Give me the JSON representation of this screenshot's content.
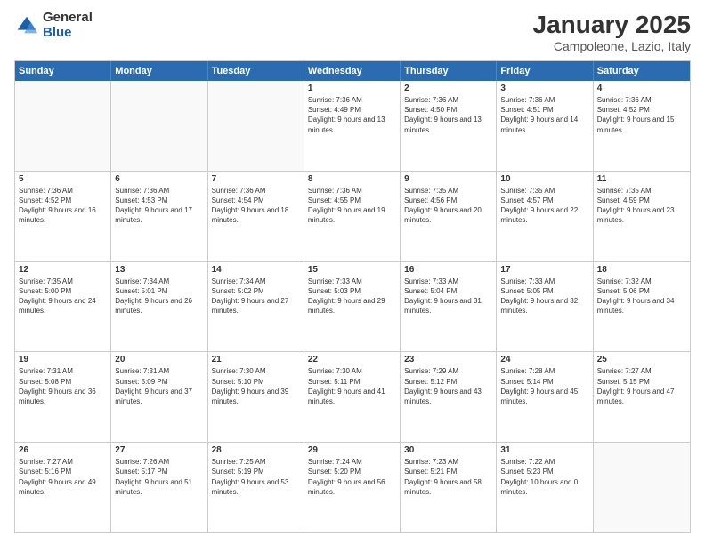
{
  "logo": {
    "general": "General",
    "blue": "Blue"
  },
  "header": {
    "month": "January 2025",
    "location": "Campoleone, Lazio, Italy"
  },
  "days": [
    "Sunday",
    "Monday",
    "Tuesday",
    "Wednesday",
    "Thursday",
    "Friday",
    "Saturday"
  ],
  "rows": [
    [
      {
        "day": "",
        "empty": true
      },
      {
        "day": "",
        "empty": true
      },
      {
        "day": "",
        "empty": true
      },
      {
        "day": "1",
        "sunrise": "7:36 AM",
        "sunset": "4:49 PM",
        "daylight": "9 hours and 13 minutes."
      },
      {
        "day": "2",
        "sunrise": "7:36 AM",
        "sunset": "4:50 PM",
        "daylight": "9 hours and 13 minutes."
      },
      {
        "day": "3",
        "sunrise": "7:36 AM",
        "sunset": "4:51 PM",
        "daylight": "9 hours and 14 minutes."
      },
      {
        "day": "4",
        "sunrise": "7:36 AM",
        "sunset": "4:52 PM",
        "daylight": "9 hours and 15 minutes."
      }
    ],
    [
      {
        "day": "5",
        "sunrise": "7:36 AM",
        "sunset": "4:52 PM",
        "daylight": "9 hours and 16 minutes."
      },
      {
        "day": "6",
        "sunrise": "7:36 AM",
        "sunset": "4:53 PM",
        "daylight": "9 hours and 17 minutes."
      },
      {
        "day": "7",
        "sunrise": "7:36 AM",
        "sunset": "4:54 PM",
        "daylight": "9 hours and 18 minutes."
      },
      {
        "day": "8",
        "sunrise": "7:36 AM",
        "sunset": "4:55 PM",
        "daylight": "9 hours and 19 minutes."
      },
      {
        "day": "9",
        "sunrise": "7:35 AM",
        "sunset": "4:56 PM",
        "daylight": "9 hours and 20 minutes."
      },
      {
        "day": "10",
        "sunrise": "7:35 AM",
        "sunset": "4:57 PM",
        "daylight": "9 hours and 22 minutes."
      },
      {
        "day": "11",
        "sunrise": "7:35 AM",
        "sunset": "4:59 PM",
        "daylight": "9 hours and 23 minutes."
      }
    ],
    [
      {
        "day": "12",
        "sunrise": "7:35 AM",
        "sunset": "5:00 PM",
        "daylight": "9 hours and 24 minutes."
      },
      {
        "day": "13",
        "sunrise": "7:34 AM",
        "sunset": "5:01 PM",
        "daylight": "9 hours and 26 minutes."
      },
      {
        "day": "14",
        "sunrise": "7:34 AM",
        "sunset": "5:02 PM",
        "daylight": "9 hours and 27 minutes."
      },
      {
        "day": "15",
        "sunrise": "7:33 AM",
        "sunset": "5:03 PM",
        "daylight": "9 hours and 29 minutes."
      },
      {
        "day": "16",
        "sunrise": "7:33 AM",
        "sunset": "5:04 PM",
        "daylight": "9 hours and 31 minutes."
      },
      {
        "day": "17",
        "sunrise": "7:33 AM",
        "sunset": "5:05 PM",
        "daylight": "9 hours and 32 minutes."
      },
      {
        "day": "18",
        "sunrise": "7:32 AM",
        "sunset": "5:06 PM",
        "daylight": "9 hours and 34 minutes."
      }
    ],
    [
      {
        "day": "19",
        "sunrise": "7:31 AM",
        "sunset": "5:08 PM",
        "daylight": "9 hours and 36 minutes."
      },
      {
        "day": "20",
        "sunrise": "7:31 AM",
        "sunset": "5:09 PM",
        "daylight": "9 hours and 37 minutes."
      },
      {
        "day": "21",
        "sunrise": "7:30 AM",
        "sunset": "5:10 PM",
        "daylight": "9 hours and 39 minutes."
      },
      {
        "day": "22",
        "sunrise": "7:30 AM",
        "sunset": "5:11 PM",
        "daylight": "9 hours and 41 minutes."
      },
      {
        "day": "23",
        "sunrise": "7:29 AM",
        "sunset": "5:12 PM",
        "daylight": "9 hours and 43 minutes."
      },
      {
        "day": "24",
        "sunrise": "7:28 AM",
        "sunset": "5:14 PM",
        "daylight": "9 hours and 45 minutes."
      },
      {
        "day": "25",
        "sunrise": "7:27 AM",
        "sunset": "5:15 PM",
        "daylight": "9 hours and 47 minutes."
      }
    ],
    [
      {
        "day": "26",
        "sunrise": "7:27 AM",
        "sunset": "5:16 PM",
        "daylight": "9 hours and 49 minutes."
      },
      {
        "day": "27",
        "sunrise": "7:26 AM",
        "sunset": "5:17 PM",
        "daylight": "9 hours and 51 minutes."
      },
      {
        "day": "28",
        "sunrise": "7:25 AM",
        "sunset": "5:19 PM",
        "daylight": "9 hours and 53 minutes."
      },
      {
        "day": "29",
        "sunrise": "7:24 AM",
        "sunset": "5:20 PM",
        "daylight": "9 hours and 56 minutes."
      },
      {
        "day": "30",
        "sunrise": "7:23 AM",
        "sunset": "5:21 PM",
        "daylight": "9 hours and 58 minutes."
      },
      {
        "day": "31",
        "sunrise": "7:22 AM",
        "sunset": "5:23 PM",
        "daylight": "10 hours and 0 minutes."
      },
      {
        "day": "",
        "empty": true
      }
    ]
  ]
}
